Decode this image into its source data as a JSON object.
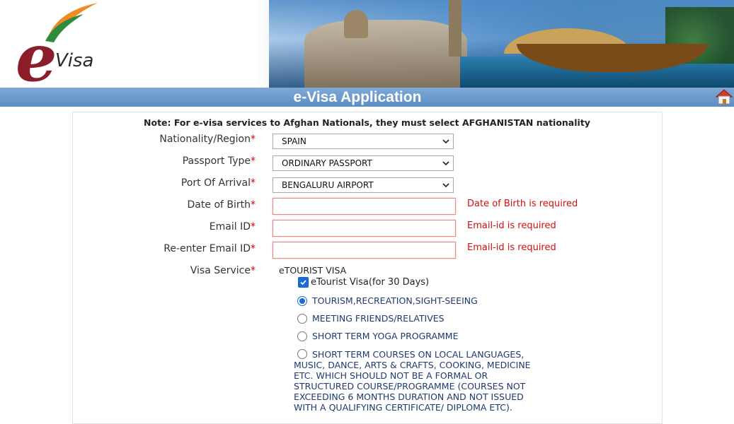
{
  "header": {
    "logo_text": "Visa",
    "logo_initial": "e"
  },
  "titlebar": {
    "title": "e-Visa Application"
  },
  "form": {
    "note": "Note: For e-visa services to Afghan Nationals, they must select AFGHANISTAN nationality",
    "required_mark": "*",
    "fields": {
      "nationality": {
        "label": "Nationality/Region",
        "value": "SPAIN"
      },
      "passport_type": {
        "label": "Passport Type",
        "value": "ORDINARY PASSPORT"
      },
      "port_of_arrival": {
        "label": "Port Of Arrival",
        "value": "BENGALURU AIRPORT"
      },
      "dob": {
        "label": "Date of Birth",
        "value": "",
        "error": "Date of Birth is required"
      },
      "email": {
        "label": "Email ID",
        "value": "",
        "error": "Email-id is required"
      },
      "reemail": {
        "label": "Re-enter Email ID",
        "value": "",
        "error": "Email-id is required"
      },
      "visa_service": {
        "label": "Visa Service"
      }
    },
    "visa_service": {
      "type": "eTOURIST VISA",
      "checkbox_label": "eTourist Visa(for 30 Days)",
      "checkbox_checked": true,
      "options": [
        {
          "label": "TOURISM,RECREATION,SIGHT-SEEING",
          "selected": true
        },
        {
          "label": "MEETING FRIENDS/RELATIVES",
          "selected": false
        },
        {
          "label": "SHORT TERM YOGA PROGRAMME",
          "selected": false
        },
        {
          "label": "SHORT TERM COURSES ON LOCAL LANGUAGES, MUSIC, DANCE, ARTS & CRAFTS, COOKING, MEDICINE ETC. WHICH SHOULD NOT BE A FORMAL OR STRUCTURED COURSE/PROGRAMME (COURSES NOT EXCEEDING 6 MONTHS DURATION AND NOT ISSUED WITH A QUALIFYING CERTIFICATE/ DIPLOMA ETC).",
          "selected": false
        }
      ]
    }
  },
  "colors": {
    "titlebar": "#6b9ad0",
    "error": "#d01010",
    "accent": "#1a6bd6",
    "option_text": "#1f3a6e"
  }
}
